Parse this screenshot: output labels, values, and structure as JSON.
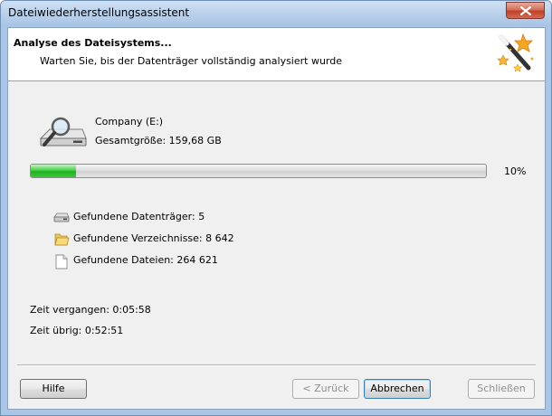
{
  "window": {
    "title": "Dateiwiederherstellungsassistent"
  },
  "header": {
    "title": "Analyse des Dateisystems...",
    "subtitle": "Warten Sie, bis der Datenträger vollständig analysiert wurde"
  },
  "drive": {
    "name": "Company (E:)",
    "size": "Gesamtgröße: 159,68 GB",
    "icon": "hard-drive-magnifier-icon"
  },
  "progress": {
    "percent_text": "10%",
    "fraction": 0.1,
    "color": "#2ec42e"
  },
  "stats": [
    {
      "icon": "drive-icon",
      "label": "Gefundene Datenträger: 5"
    },
    {
      "icon": "folder-icon",
      "label": "Gefundene Verzeichnisse: 8 642"
    },
    {
      "icon": "file-icon",
      "label": "Gefundene Dateien: 264 621"
    }
  ],
  "time": {
    "elapsed": "Zeit vergangen: 0:05:58",
    "remaining": "Zeit übrig: 0:52:51"
  },
  "buttons": {
    "help": "Hilfe",
    "back": "< Zurück",
    "cancel": "Abbrechen",
    "close": "Schließen"
  }
}
